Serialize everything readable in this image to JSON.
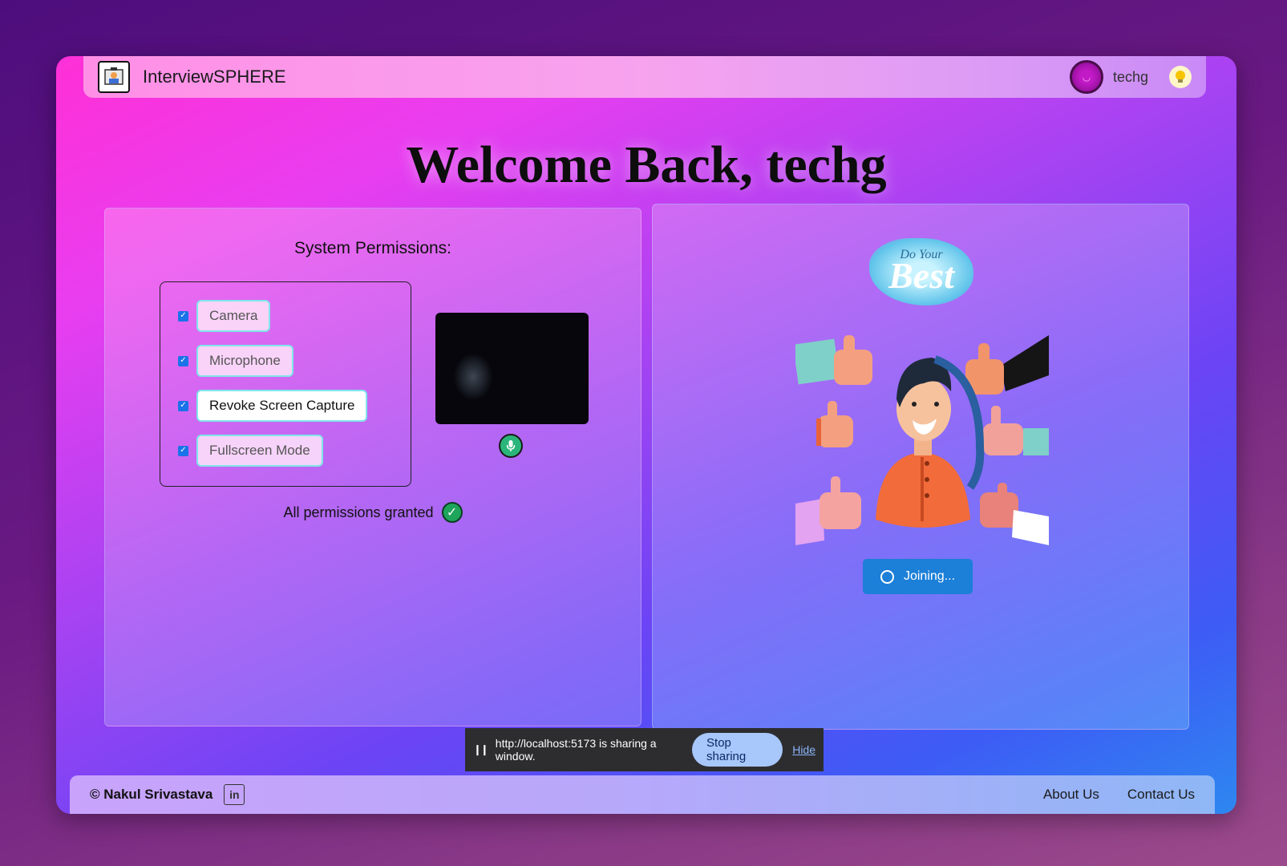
{
  "header": {
    "app_title": "InterviewSPHERE",
    "username": "techg"
  },
  "welcome": "Welcome Back, techg",
  "permissions": {
    "title": "System Permissions:",
    "items": [
      {
        "label": "Camera",
        "checked": true
      },
      {
        "label": "Microphone",
        "checked": true
      },
      {
        "label": "Revoke Screen Capture",
        "checked": true
      },
      {
        "label": "Fullscreen Mode",
        "checked": true
      }
    ],
    "status": "All permissions granted"
  },
  "right_panel": {
    "badge_small": "Do Your",
    "badge_big": "Best",
    "joining_label": "Joining..."
  },
  "share_bar": {
    "message": "http://localhost:5173 is sharing a window.",
    "stop_label": "Stop sharing",
    "hide_label": "Hide"
  },
  "footer": {
    "copyright": "© Nakul Srivastava",
    "links": [
      "About Us",
      "Contact Us"
    ]
  },
  "colors": {
    "accent": "#1c7fd8",
    "success": "#1fa45c",
    "checkbox": "#1a73e8"
  }
}
